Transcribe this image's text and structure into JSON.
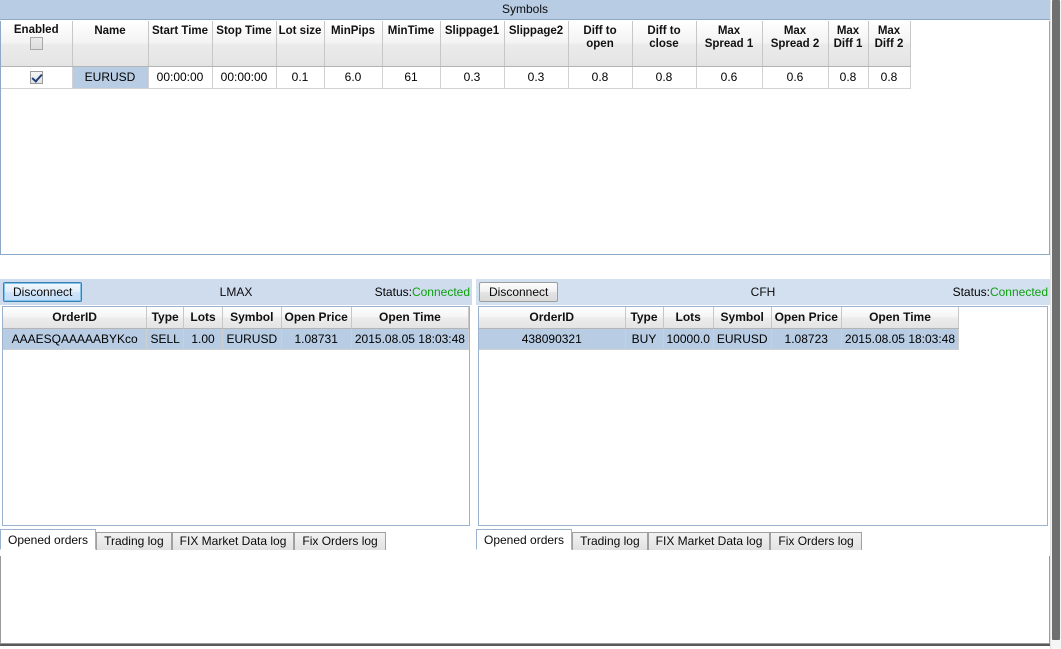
{
  "window": {
    "title": "Symbols"
  },
  "symbols_table": {
    "headers": [
      "Enabled",
      "Name",
      "Start Time",
      "Stop Time",
      "Lot size",
      "MinPips",
      "MinTime",
      "Slippage1",
      "Slippage2",
      "Diff to open",
      "Diff to close",
      "Max Spread 1",
      "Max Spread 2",
      "Max Diff 1",
      "Max Diff 2"
    ],
    "header_select_all_checked": false,
    "rows": [
      {
        "enabled": true,
        "name": "EURUSD",
        "start_time": "00:00:00",
        "stop_time": "00:00:00",
        "lot_size": "0.1",
        "min_pips": "6.0",
        "min_time": "61",
        "slippage1": "0.3",
        "slippage2": "0.3",
        "diff_to_open": "0.8",
        "diff_to_close": "0.8",
        "max_spread_1": "0.6",
        "max_spread_2": "0.6",
        "max_diff_1": "0.8",
        "max_diff_2": "0.8"
      }
    ]
  },
  "panels": [
    {
      "id": "lmax",
      "button_label": "Disconnect",
      "title": "LMAX",
      "status_label": "Status:",
      "status_value": "Connected",
      "status_color": "#10a010",
      "orders_headers": [
        "OrderID",
        "Type",
        "Lots",
        "Symbol",
        "Open Price",
        "Open Time"
      ],
      "orders_rows": [
        {
          "order_id": "AAAESQAAAAABYKco",
          "type": "SELL",
          "lots": "1.00",
          "symbol": "EURUSD",
          "open_price": "1.08731",
          "open_time": "2015.08.05 18:03:48"
        }
      ],
      "tabs": [
        "Opened orders",
        "Trading log",
        "FIX Market Data log",
        "Fix Orders log"
      ],
      "active_tab": "Opened orders"
    },
    {
      "id": "cfh",
      "button_label": "Disconnect",
      "title": "CFH",
      "status_label": "Status:",
      "status_value": "Connected",
      "status_color": "#10a010",
      "orders_headers": [
        "OrderID",
        "Type",
        "Lots",
        "Symbol",
        "Open Price",
        "Open Time"
      ],
      "orders_rows": [
        {
          "order_id": "438090321",
          "type": "BUY",
          "lots": "10000.0",
          "symbol": "EURUSD",
          "open_price": "1.08723",
          "open_time": "2015.08.05 18:03:48"
        }
      ],
      "tabs": [
        "Opened orders",
        "Trading log",
        "FIX Market Data log",
        "Fix Orders log"
      ],
      "active_tab": "Opened orders"
    }
  ],
  "theme": {
    "title_bar_bg": "#b8cce4",
    "selection_bg": "#b8cce4",
    "panel_header_bg": "#d3e0f0",
    "grid_line": "#cfcfcf"
  }
}
